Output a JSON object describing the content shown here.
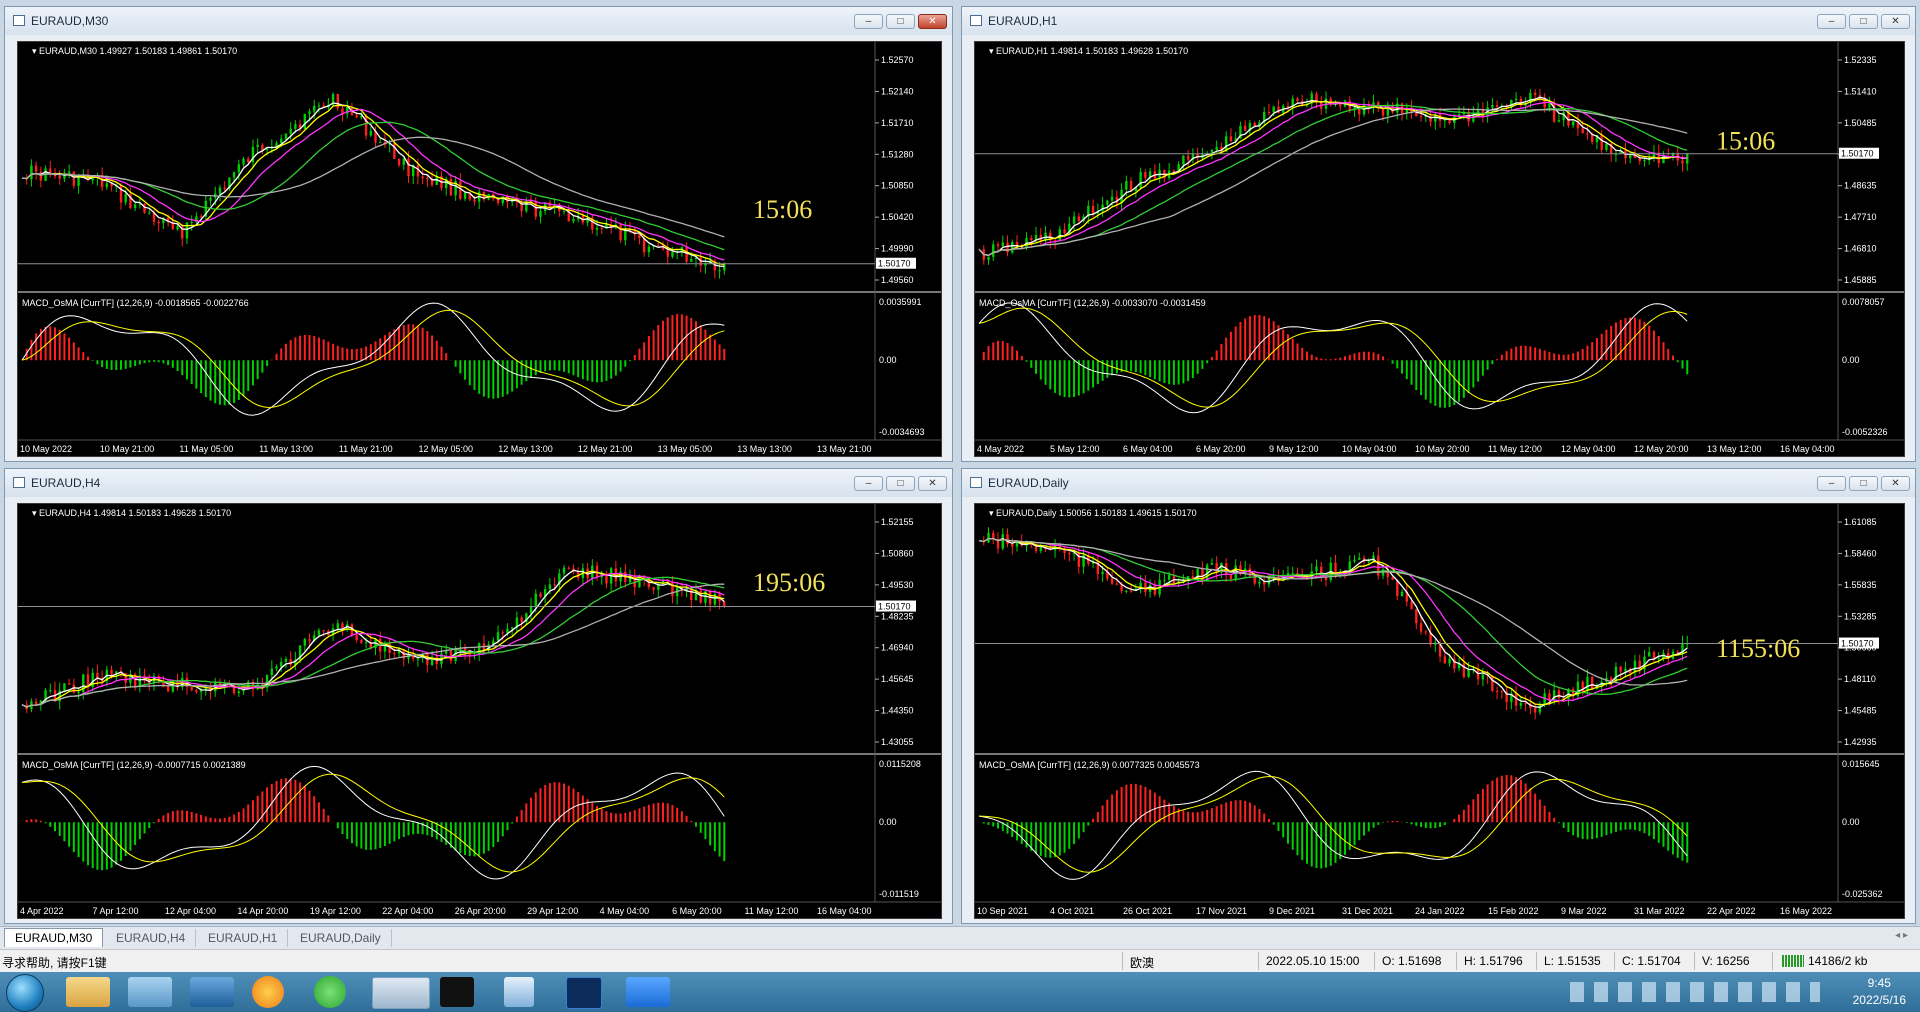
{
  "windows": [
    {
      "id": "m30",
      "title": "EURAUD,M30",
      "ohlc_label": "EURAUD,M30  1.49927 1.50183 1.49861 1.50170",
      "price_ticks": [
        "1.52570",
        "1.52140",
        "1.51710",
        "1.51280",
        "1.50850",
        "1.50420",
        "1.49990",
        "1.49560"
      ],
      "current_price": "1.50170",
      "indicator_label": "MACD_OsMA [CurrTF] (12,26,9) -0.0018565 -0.0022766",
      "indicator_ticks": [
        "0.0035991",
        "0.00",
        "-0.0034693"
      ],
      "time_ticks": [
        "10 May 2022",
        "10 May 21:00",
        "11 May 05:00",
        "11 May 13:00",
        "11 May 21:00",
        "12 May 05:00",
        "12 May 13:00",
        "12 May 21:00",
        "13 May 05:00",
        "13 May 13:00",
        "13 May 21:00"
      ],
      "timer": "15:06"
    },
    {
      "id": "h1",
      "title": "EURAUD,H1",
      "ohlc_label": "EURAUD,H1  1.49814 1.50183 1.49628 1.50170",
      "price_ticks": [
        "1.52335",
        "1.51410",
        "1.50485",
        "1.49560",
        "1.48635",
        "1.47710",
        "1.46810",
        "1.45885"
      ],
      "current_price": "1.50170",
      "indicator_label": "MACD_OsMA [CurrTF] (12,26,9) -0.0033070 -0.0031459",
      "indicator_ticks": [
        "0.0078057",
        "0.00",
        "-0.0052326"
      ],
      "time_ticks": [
        "4 May 2022",
        "5 May 12:00",
        "6 May 04:00",
        "6 May 20:00",
        "9 May 12:00",
        "10 May 04:00",
        "10 May 20:00",
        "11 May 12:00",
        "12 May 04:00",
        "12 May 20:00",
        "13 May 12:00",
        "16 May 04:00"
      ],
      "timer": "15:06"
    },
    {
      "id": "h4",
      "title": "EURAUD,H4",
      "ohlc_label": "EURAUD,H4  1.49814 1.50183 1.49628 1.50170",
      "price_ticks": [
        "1.52155",
        "1.50860",
        "1.49530",
        "1.48235",
        "1.46940",
        "1.45645",
        "1.44350",
        "1.43055"
      ],
      "current_price": "1.50170",
      "indicator_label": "MACD_OsMA [CurrTF] (12,26,9) -0.0007715 0.0021389",
      "indicator_ticks": [
        "0.0115208",
        "0.00",
        "-0.011519"
      ],
      "time_ticks": [
        "4 Apr 2022",
        "7 Apr 12:00",
        "12 Apr 04:00",
        "14 Apr 20:00",
        "19 Apr 12:00",
        "22 Apr 04:00",
        "26 Apr 20:00",
        "29 Apr 12:00",
        "4 May 04:00",
        "6 May 20:00",
        "11 May 12:00",
        "16 May 04:00"
      ],
      "timer": "195:06"
    },
    {
      "id": "d1",
      "title": "EURAUD,Daily",
      "ohlc_label": "EURAUD,Daily  1.50056 1.50183 1.49615 1.50170",
      "price_ticks": [
        "1.61085",
        "1.58460",
        "1.55835",
        "1.53285",
        "1.50660",
        "1.48110",
        "1.45485",
        "1.42935"
      ],
      "current_price": "1.50170",
      "indicator_label": "MACD_OsMA [CurrTF] (12,26,9) 0.0077325 0.0045573",
      "indicator_ticks": [
        "0.015645",
        "0.00",
        "-0.025362"
      ],
      "time_ticks": [
        "10 Sep 2021",
        "4 Oct 2021",
        "26 Oct 2021",
        "17 Nov 2021",
        "9 Dec 2021",
        "31 Dec 2021",
        "24 Jan 2022",
        "15 Feb 2022",
        "9 Mar 2022",
        "31 Mar 2022",
        "22 Apr 2022",
        "16 May 2022"
      ],
      "timer": "1155:06"
    }
  ],
  "window_buttons": {
    "minimize": "–",
    "maximize": "□",
    "close": "✕"
  },
  "tabs": [
    "EURAUD,M30",
    "EURAUD,H4",
    "EURAUD,H1",
    "EURAUD,Daily"
  ],
  "active_tab": "EURAUD,M30",
  "status": {
    "help": "寻求帮助, 请按F1键",
    "profile": "欧澳",
    "datetime": "2022.05.10 15:00",
    "open": "O: 1.51698",
    "high": "H: 1.51796",
    "low": "L: 1.51535",
    "close": "C: 1.51704",
    "volume": "V: 16256",
    "traffic": "14186/2 kb"
  },
  "clock": {
    "time": "9:45",
    "date": "2022/5/16"
  },
  "colors": {
    "background": "#000000",
    "bull": "#00d000",
    "bear": "#ff2020",
    "ma_fast": "#ffffff",
    "ma_yellow": "#ffff00",
    "ma_magenta": "#ff33ff",
    "ma_green": "#33cc33",
    "ma_gray": "#b0b0b0",
    "timer": "#f4e15a"
  },
  "icons": [
    "start-orb-icon",
    "folder-icon",
    "people-icon",
    "desktop-icon",
    "browser-icon",
    "wechat-icon",
    "mt4-icon",
    "capcut-icon",
    "notepad-icon",
    "photoshop-icon",
    "pen-app-icon"
  ]
}
